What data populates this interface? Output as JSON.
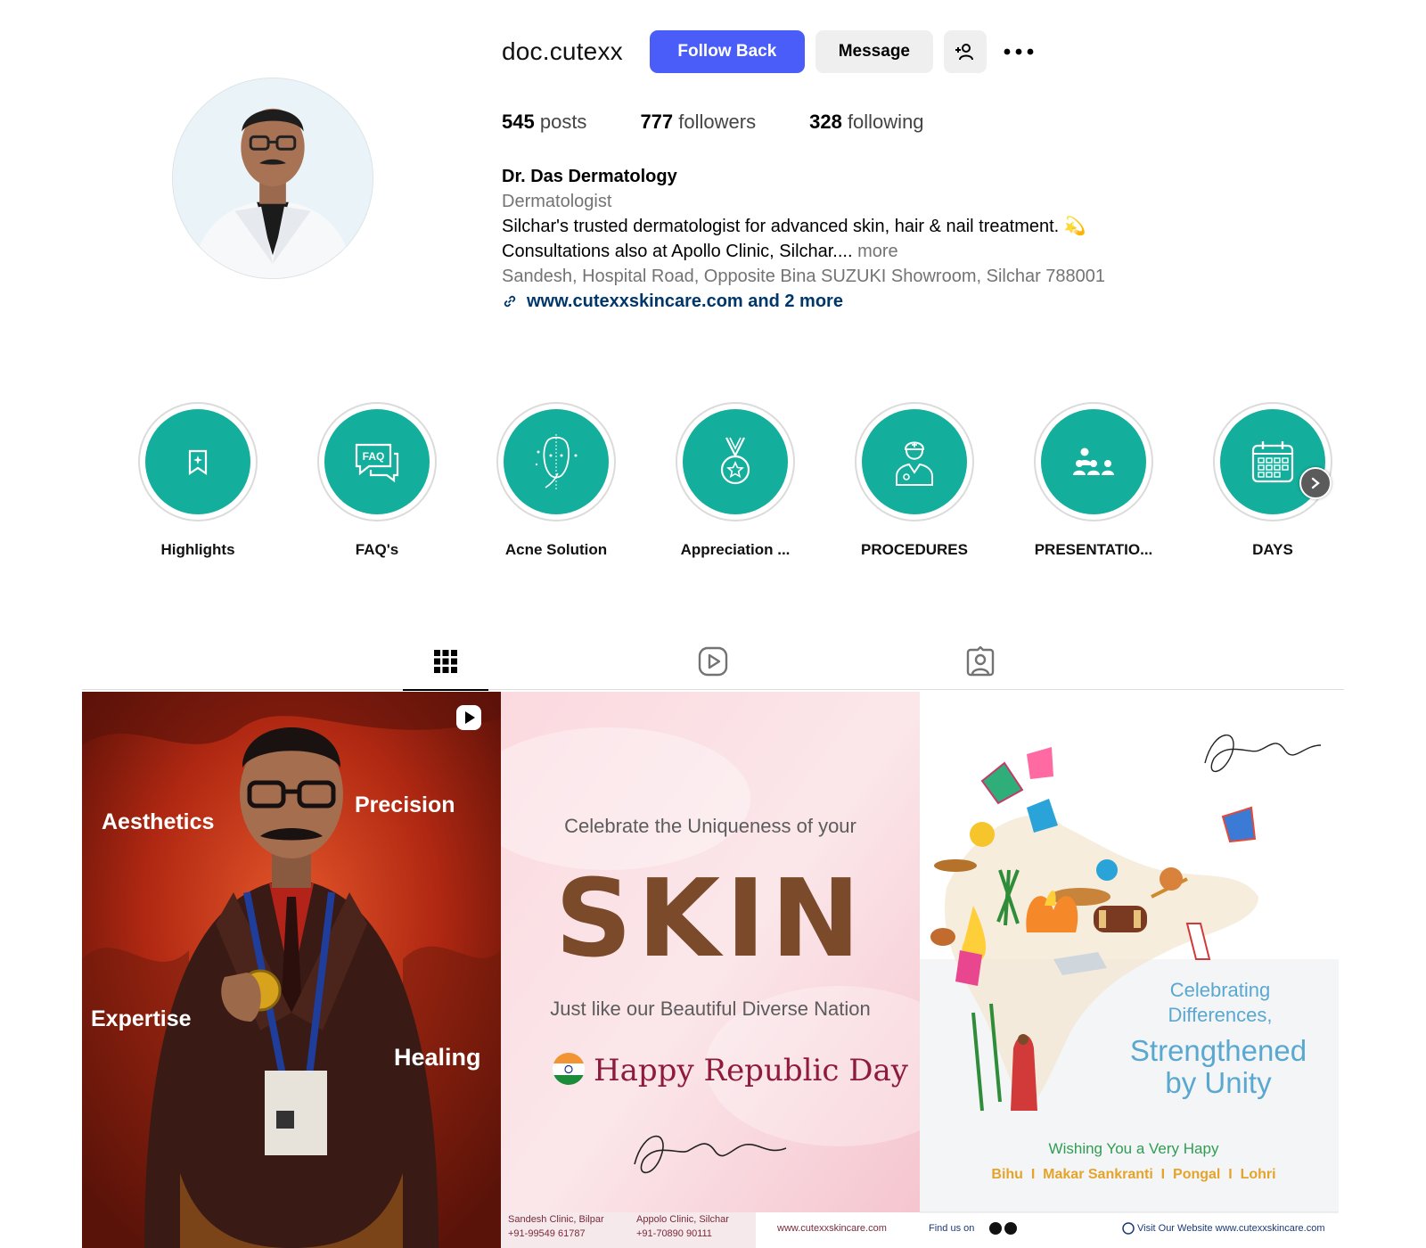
{
  "profile": {
    "username": "doc.cutexx",
    "follow_label": "Follow Back",
    "message_label": "Message",
    "stats": {
      "posts_count": "545",
      "posts_label": "posts",
      "followers_count": "777",
      "followers_label": "followers",
      "following_count": "328",
      "following_label": "following"
    },
    "bio": {
      "name": "Dr. Das Dermatology",
      "category": "Dermatologist",
      "line1": "Silchar's trusted dermatologist for advanced skin, hair & nail treatment. 💫",
      "line2": "Consultations also at Apollo Clinic, Silchar....",
      "more": "more",
      "address": "Sandesh, Hospital Road, Opposite Bina SUZUKI Showroom, Silchar 788001",
      "link": "www.cutexxskincare.com and 2 more"
    }
  },
  "highlights": [
    {
      "label": "Highlights",
      "icon": "bookmark-sparkle-icon"
    },
    {
      "label": "FAQ's",
      "icon": "faq-bubble-icon"
    },
    {
      "label": "Acne Solution",
      "icon": "face-icon"
    },
    {
      "label": "Appreciation ...",
      "icon": "medal-icon"
    },
    {
      "label": "PROCEDURES",
      "icon": "doctor-icon"
    },
    {
      "label": "PRESENTATIO...",
      "icon": "audience-icon"
    },
    {
      "label": "DAYS",
      "icon": "calendar-icon"
    }
  ],
  "tabs": [
    {
      "name": "posts",
      "icon": "grid-icon",
      "active": true
    },
    {
      "name": "reels",
      "icon": "reels-icon",
      "active": false
    },
    {
      "name": "tagged",
      "icon": "tagged-icon",
      "active": false
    }
  ],
  "posts": {
    "post1": {
      "words": [
        "Aesthetics",
        "Precision",
        "Expertise",
        "Healing"
      ]
    },
    "post2": {
      "line1": "Celebrate the Uniqueness of your",
      "big": "SKIN",
      "line2": "Just like our Beautiful Diverse Nation",
      "greeting": "Happy Republic Day",
      "footer_left_1": "Sandesh Clinic, Bilpar",
      "footer_left_2": "+91-99549 61787",
      "footer_mid_1": "Appolo Clinic, Silchar",
      "footer_mid_2": "+91-70890 90111",
      "footer_right": "www.cutexxskincare.com"
    },
    "post3": {
      "celebrating": "Celebrating",
      "differences": "Differences,",
      "strengthened": "Strengthened",
      "unity": "by Unity",
      "wishing": "Wishing You a Very Hapy",
      "festivals": "Bihu  I  Makar Sankranti  I  Pongal  I  Lohri",
      "find_us": "Find us on",
      "visit": "Visit Our Website  www.cutexxskincare.com"
    }
  },
  "colors": {
    "accent_blue": "#4a5df9",
    "teal": "#13ae9c",
    "link": "#00376b",
    "secondary_text": "#737373"
  }
}
